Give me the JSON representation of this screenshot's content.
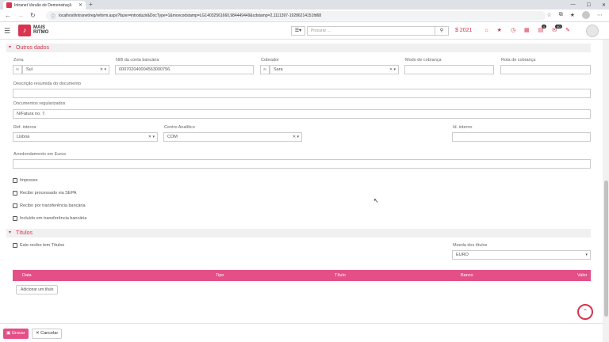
{
  "browser": {
    "tab_title": "Intranet Versão de Demonstraçã",
    "url": "localhost/intranet/reg/reform.aspx?fazer=introduzir&DocType=1&movcodstamp=LG14032561660,984449449&cdstamp=2,1111397-19286214151fd68",
    "win_min": "—",
    "win_max": "☐",
    "win_close": "✕"
  },
  "app": {
    "logo_line1": "MAIS",
    "logo_line2": "RITMO",
    "search_placeholder": "Procurar ...",
    "year": "2021",
    "badge_1": "4",
    "badge_2": "40"
  },
  "section_outros": {
    "title": "Outros dados",
    "zona_label": "Zona",
    "zona_prefix": "N",
    "zona_value": "Sul",
    "nif_label": "NIB da conta bancária",
    "nif_value": "000702040004563000756",
    "cobrador_label": "Cobrador",
    "cobrador_prefix": "N",
    "cobrador_value": "Sara",
    "modo_label": "Modo de cobrança",
    "rota_label": "Rota de cobrança",
    "descricao_label": "Descrição resumida do documento",
    "docs_label": "Documentos regularizados",
    "docs_value": "N/Fatura no. 7.",
    "ref_label": "Ref. interna",
    "ref_value": "Lisboa",
    "centro_label": "Centro Analítico",
    "centro_value": "COM",
    "id_label": "Id. interno",
    "arred_label": "Arredondamento em Euros",
    "chk_impresso": "Impresso",
    "chk_sepa": "Recibo processado via SEPA",
    "chk_transf": "Recibo por transferência bancária",
    "chk_incluido": "Incluído em transferência bancária"
  },
  "section_titulos": {
    "title": "Títulos",
    "chk_tem_titulos": "Este recibo tem Títulos",
    "moeda_label": "Moeda dos títulos",
    "moeda_value": "EURO",
    "columns": [
      "Data",
      "Tipo",
      "Título",
      "Banco",
      "Valor"
    ],
    "add_button": "Adicionar um título"
  },
  "footer": {
    "save": "Gravar",
    "cancel": "Cancelar"
  }
}
